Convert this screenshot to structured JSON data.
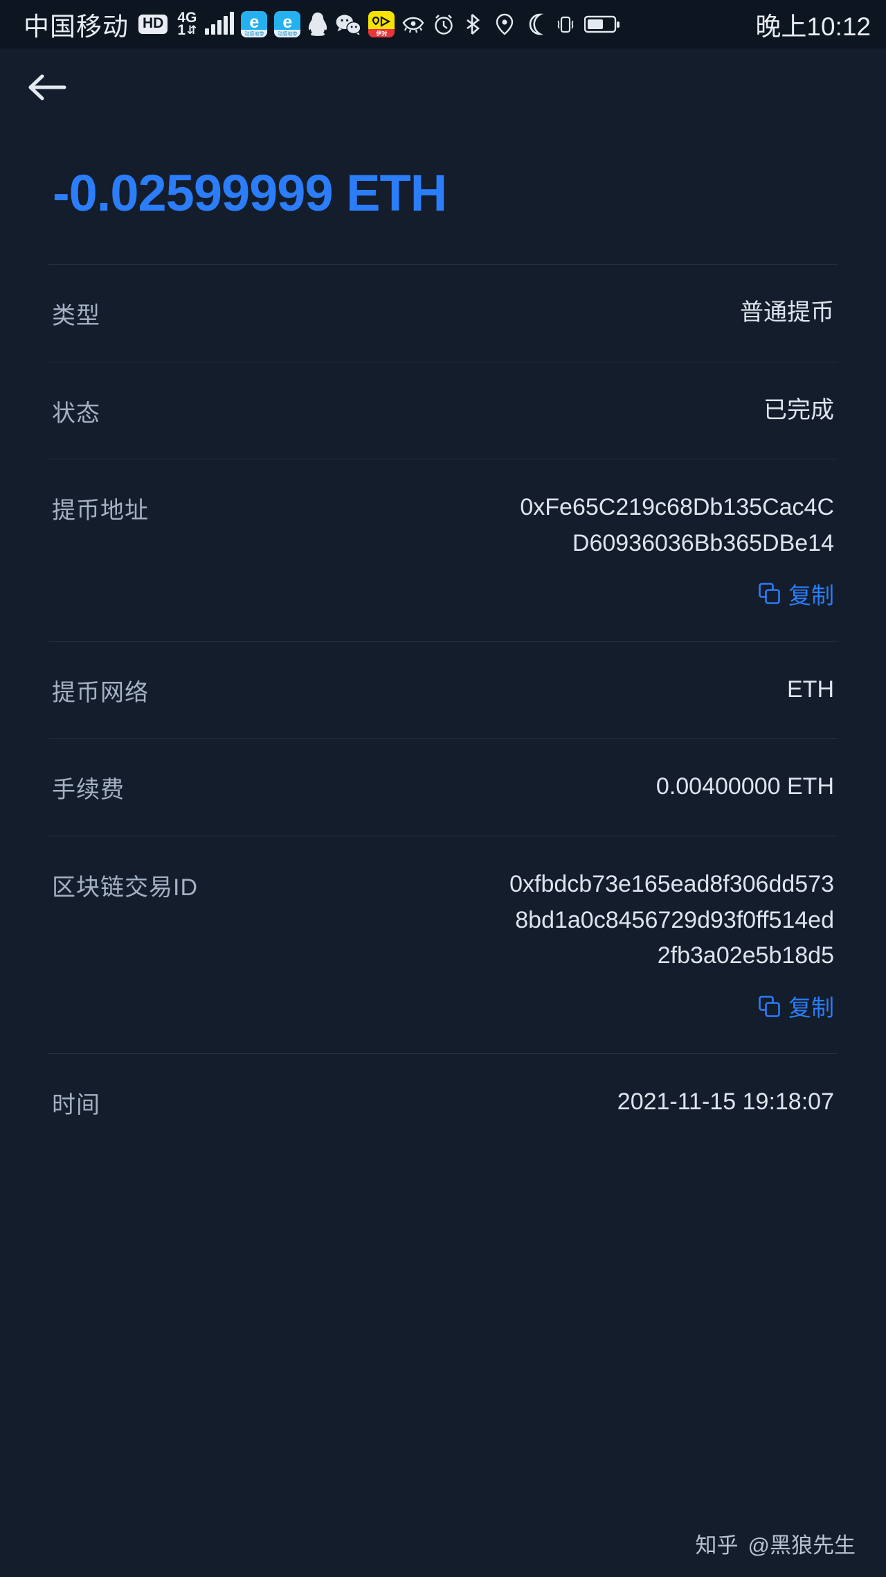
{
  "status_bar": {
    "carrier": "中国移动",
    "hd_badge": "HD",
    "network_type": "4G",
    "network_sub": "1",
    "app_badges": [
      {
        "name": "e-surfing-icon",
        "glyph": "e",
        "sub": "动感地带"
      },
      {
        "name": "e-surfing-icon-2",
        "glyph": "e",
        "sub": "动感地带"
      },
      {
        "name": "qq-icon",
        "glyph": ""
      },
      {
        "name": "wechat-icon",
        "glyph": ""
      },
      {
        "name": "yitui-icon",
        "glyph": "",
        "sub": "伊对"
      }
    ],
    "system_icons": [
      "eye-care-icon",
      "alarm-clock-icon",
      "bluetooth-icon",
      "location-pin-icon",
      "do-not-disturb-moon-icon",
      "vibrate-icon",
      "battery-icon"
    ],
    "time": "晚上10:12"
  },
  "header": {
    "back_icon": "arrow-left-icon"
  },
  "transaction": {
    "amount": "-0.02599999 ETH",
    "amount_color": "#2b7dfa",
    "rows": [
      {
        "label": "类型",
        "value": "普通提币",
        "copy": false
      },
      {
        "label": "状态",
        "value": "已完成",
        "copy": false
      },
      {
        "label": "提币地址",
        "value": "0xFe65C219c68Db135Cac4CD60936036Bb365DBe14",
        "copy": true
      },
      {
        "label": "提币网络",
        "value": "ETH",
        "copy": false
      },
      {
        "label": "手续费",
        "value": "0.00400000 ETH",
        "copy": false
      },
      {
        "label": "区块链交易ID",
        "value": "0xfbdcb73e165ead8f306dd5738bd1a0c8456729d93f0ff514ed2fb3a02e5b18d5",
        "copy": true
      },
      {
        "label": "时间",
        "value": "2021-11-15 19:18:07",
        "copy": false
      }
    ],
    "copy_label": "复制",
    "copy_icon": "copy-pages-icon"
  },
  "watermark": {
    "platform": "知乎",
    "author": "@黑狼先生"
  }
}
